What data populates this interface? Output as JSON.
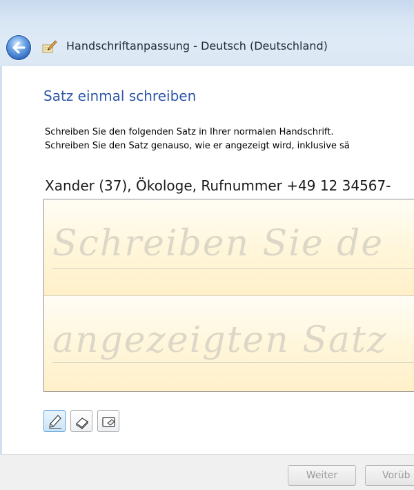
{
  "window": {
    "title": "Handschriftanpassung - Deutsch (Deutschland)"
  },
  "page": {
    "heading": "Satz einmal schreiben",
    "instruction_line1": "Schreiben Sie den folgenden Satz in Ihrer normalen Handschrift.",
    "instruction_line2": "Schreiben Sie den Satz genauso, wie er angezeigt wird, inklusive sä",
    "sentence": "Xander (37), Ökologe, Rufnummer +49 12 34567-"
  },
  "writing_pad": {
    "hint_line1": "Schreiben Sie de",
    "hint_line2": "angezeigten Satz"
  },
  "tools": [
    {
      "name": "pen-icon",
      "active": true
    },
    {
      "name": "eraser-icon",
      "active": false
    },
    {
      "name": "clear-icon",
      "active": false
    }
  ],
  "buttons": {
    "next": "Weiter",
    "preview": "Vorüb"
  },
  "colors": {
    "heading": "#2e57a6",
    "pad_background": "#fff6db",
    "title_bar": "#dbe7f4"
  }
}
